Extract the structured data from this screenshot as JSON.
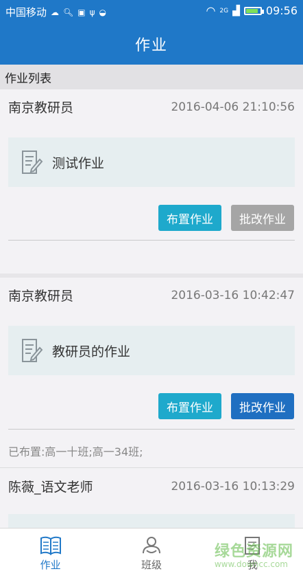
{
  "status_bar": {
    "carrier": "中国移动",
    "network_badge": "2G",
    "time": "09:56",
    "battery_level": 0.85,
    "icons": [
      "cloud-icon",
      "search-icon",
      "radio-icon",
      "usb-icon",
      "android-icon",
      "wifi-icon",
      "signal-icon",
      "battery-icon"
    ]
  },
  "app_bar": {
    "title": "作业"
  },
  "section": {
    "title": "作业列表"
  },
  "buttons": {
    "assign": "布置作业",
    "grade": "批改作业"
  },
  "homework": [
    {
      "author": "南京教研员",
      "time": "2016-04-06 21:10:56",
      "title": "测试作业",
      "assigned": ""
    },
    {
      "author": "南京教研员",
      "time": "2016-03-16 10:42:47",
      "title": "教研员的作业",
      "assigned": "已布置:高一十班;高一34班;"
    },
    {
      "author": "陈薇_语文老师",
      "time": "2016-03-16 10:13:29",
      "title": "",
      "assigned": ""
    }
  ],
  "tabs": [
    {
      "label": "作业",
      "icon": "book-icon",
      "active": true
    },
    {
      "label": "班级",
      "icon": "class-icon",
      "active": false
    },
    {
      "label": "我",
      "icon": "profile-icon",
      "active": false
    }
  ],
  "watermark": {
    "text": "绿色资源网",
    "url": "www.downcc.com"
  },
  "colors": {
    "primary": "#1f78c8",
    "assign_button": "#1ea9cc",
    "grade_active": "#1f6fc1",
    "grade_disabled": "#a5a5a5"
  }
}
